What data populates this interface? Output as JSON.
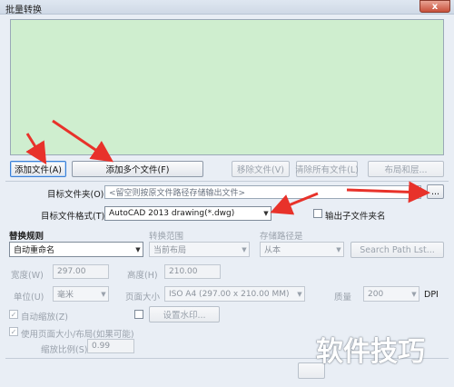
{
  "window": {
    "title": "批量转换",
    "close_label": "x"
  },
  "buttons": {
    "add_file": "添加文件(A)",
    "add_multiple": "添加多个文件(F)",
    "remove_file": "移除文件(V)",
    "clear_all": "清除所有文件(L)",
    "layout": "布局和层...",
    "browse": "...",
    "search_path": "Search Path Lst...",
    "watermark": "设置水印..."
  },
  "target_folder": {
    "label": "目标文件夹(O)",
    "placeholder": "<留空则按原文件路径存储输出文件>"
  },
  "target_format": {
    "label": "目标文件格式(T)",
    "value": "AutoCAD 2013 drawing(*.dwg)"
  },
  "output_subfolder": {
    "label": "输出子文件夹名",
    "checked": false
  },
  "replace_rule": {
    "label": "替换规则",
    "value": "自动重命名"
  },
  "convert_range": {
    "label": "转换范围",
    "value": "当前布局"
  },
  "storage_path": {
    "label": "存储路径是",
    "value": "从本"
  },
  "width": {
    "label": "宽度(W)",
    "value": "297.00"
  },
  "height": {
    "label": "高度(H)",
    "value": "210.00"
  },
  "unit": {
    "label": "单位(U)",
    "value": "毫米"
  },
  "page_size": {
    "label": "页面大小",
    "value": "ISO A4 (297.00 x 210.00 MM)"
  },
  "quality": {
    "label": "质量",
    "value": "200",
    "unit": "DPI"
  },
  "auto_zoom": {
    "label": "自动缩放(Z)",
    "checked": true
  },
  "use_page_size": {
    "label": "使用页面大小/布局(如果可能)",
    "checked": true
  },
  "zoom_ratio": {
    "label": "缩放比例(S)",
    "value": "0.99"
  },
  "watermark_text": "软件技巧",
  "colors": {
    "list_bg": "#cfeecf",
    "window_bg": "#e9eef5",
    "annotation_arrow": "#e8322a",
    "focus_border": "#3a7fd5"
  }
}
